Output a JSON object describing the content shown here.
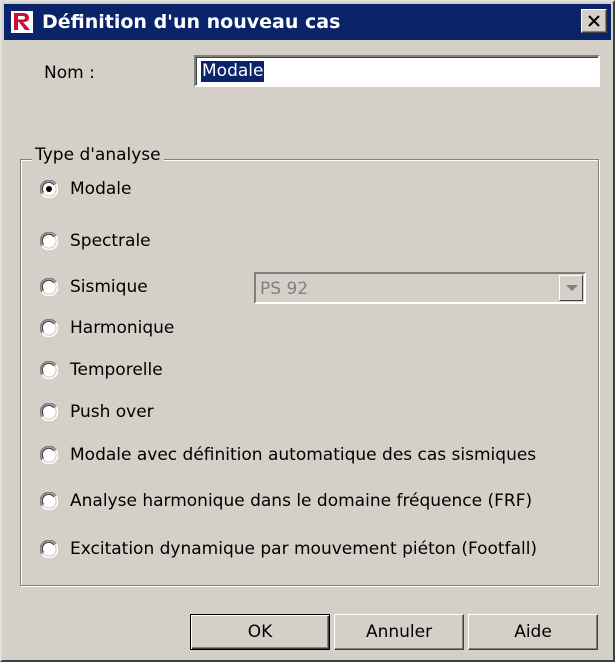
{
  "window": {
    "title": "Définition d'un nouveau cas"
  },
  "form": {
    "name_label": "Nom :",
    "name_value": "Modale"
  },
  "analysis_type": {
    "legend": "Type d'analyse",
    "options": [
      {
        "label": "Modale",
        "selected": true
      },
      {
        "label": "Spectrale",
        "selected": false
      },
      {
        "label": "Sismique",
        "selected": false
      },
      {
        "label": "Harmonique",
        "selected": false
      },
      {
        "label": "Temporelle",
        "selected": false
      },
      {
        "label": "Push over",
        "selected": false
      },
      {
        "label": "Modale avec définition automatique des cas sismiques",
        "selected": false
      },
      {
        "label": "Analyse harmonique dans le domaine fréquence (FRF)",
        "selected": false
      },
      {
        "label": "Excitation dynamique par mouvement piéton (Footfall)",
        "selected": false
      }
    ],
    "seismic_norm": {
      "selected": "PS 92",
      "enabled": false
    }
  },
  "buttons": {
    "ok": "OK",
    "cancel": "Annuler",
    "help": "Aide"
  },
  "colors": {
    "face": "#d4d0c8",
    "titlebar": "#0a246a",
    "selection": "#0a246a",
    "disabled_text": "#808080"
  },
  "icons": {
    "app": "robot-app-icon",
    "close": "close-icon",
    "dropdown": "chevron-down-icon"
  }
}
